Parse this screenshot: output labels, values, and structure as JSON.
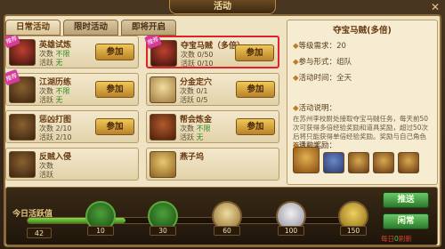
{
  "window": {
    "title": "活动",
    "close_icon": "close-icon"
  },
  "tabs": [
    {
      "label": "日常活动",
      "active": true
    },
    {
      "label": "限时活动",
      "active": false
    },
    {
      "label": "即将开启",
      "active": false
    }
  ],
  "events": [
    {
      "name": "英雄试炼",
      "count_label": "次数",
      "count_value": "不限",
      "active_label": "活跃",
      "active_value": "无",
      "button": "参加",
      "hot": true,
      "hot_text": "推荐"
    },
    {
      "name": "夺宝马贼（多倍）",
      "count_label": "次数",
      "count_value": "0/50",
      "active_label": "活跃",
      "active_value": "0/10",
      "button": "参加",
      "hot": true,
      "hot_text": "推荐",
      "selected": true
    },
    {
      "name": "江湖历练",
      "count_label": "次数",
      "count_value": "不限",
      "active_label": "活跃",
      "active_value": "无",
      "button": "参加",
      "hot": true,
      "hot_text": "推荐"
    },
    {
      "name": "分金定穴",
      "count_label": "次数",
      "count_value": "0/1",
      "active_label": "活跃",
      "active_value": "0/5",
      "button": "参加",
      "hot": false
    },
    {
      "name": "惩凶打图",
      "count_label": "次数",
      "count_value": "2/10",
      "active_label": "活跃",
      "active_value": "2/10",
      "button": "参加",
      "hot": false
    },
    {
      "name": "帮会炼金",
      "count_label": "次数",
      "count_value": "不限",
      "active_label": "活跃",
      "active_value": "无",
      "button": "参加",
      "hot": false
    },
    {
      "name": "反贼入侵",
      "count_label": "次数",
      "count_value": "",
      "active_label": "活跃",
      "active_value": "",
      "button": "",
      "hot": false
    },
    {
      "name": "燕子坞",
      "count_label": "",
      "count_value": "",
      "active_label": "",
      "active_value": "",
      "button": "",
      "hot": false
    }
  ],
  "detail": {
    "title": "夺宝马贼(多倍)",
    "level_label": "等级需求：",
    "level_value": "20",
    "form_label": "参与形式：",
    "form_value": "组队",
    "time_label": "活动时间：",
    "time_value": "全天",
    "desc_label": "活动说明：",
    "desc_text": "在苏州李校尉处接取夺宝马贼任务，每天前50次可获得多倍经验奖励和道具奖励，超过50次后将只能获得单倍经验奖励。奖励与自己角色等级有关。",
    "reward_label": "活动奖励："
  },
  "activity": {
    "label": "今日活跃值",
    "value": "42",
    "progress_fraction": 0.3,
    "milestones": [
      "10",
      "30",
      "60",
      "100",
      "150"
    ]
  },
  "buttons": {
    "push": "推送",
    "idle": "闲常"
  },
  "refresh_note": {
    "prefix": "每日",
    "hour": "0",
    "suffix": "刷新"
  }
}
